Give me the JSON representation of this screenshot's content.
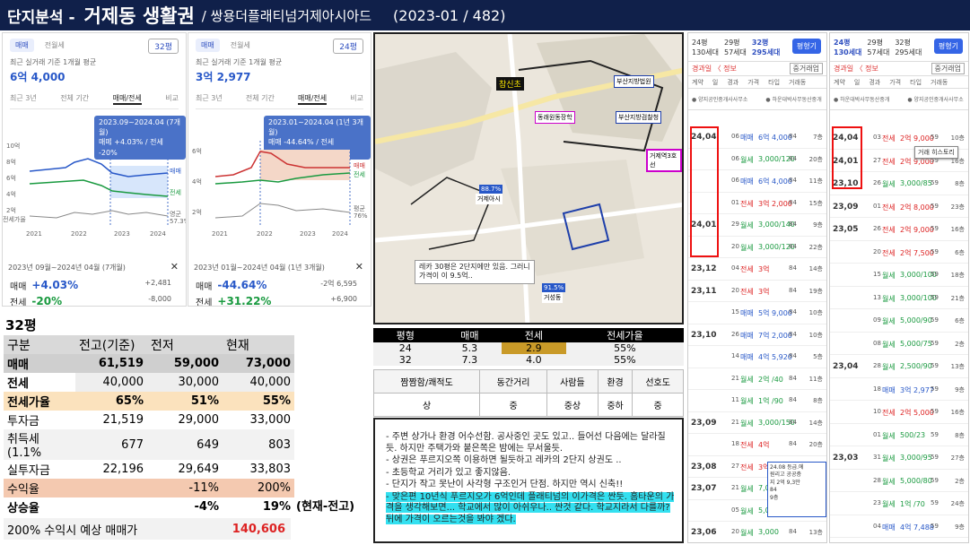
{
  "header": {
    "section": "단지분석 -",
    "region": "거제동 생활권",
    "complex": "/ 쌍용더플래티넘거제아시아드",
    "period": "(2023-01 / 482)"
  },
  "card_a": {
    "tab_sale": "매매",
    "tab_jeonse": "전월세",
    "size": "32평",
    "subtitle": "최근 실거래 기준 1개월 평균",
    "price": "6억 4,000",
    "period_tabs": [
      "최근 3년",
      "전체 기간",
      "매매/전세",
      "비교"
    ],
    "tooltip_line1": "2023.09~2024.04 (7개월)",
    "tooltip_line2": "매매 +4.03% / 전세 -20%",
    "y_ticks": [
      "10억",
      "8억",
      "6억",
      "4억",
      "2억"
    ],
    "x_ticks": [
      "2021",
      "2022",
      "2023",
      "2024"
    ],
    "legend": [
      "매매",
      "전세",
      "영군",
      "전세가율"
    ],
    "legend_extra": "57.3%",
    "range": "2023년 09월~2024년 04월 (7개월)",
    "stat_sale_label": "매매",
    "stat_sale": "+4.03%",
    "stat_sale_r": "+2,481",
    "stat_jeon_label": "전세",
    "stat_jeon": "-20%",
    "stat_jeon_r": "-8,000",
    "close_glyph": "✕"
  },
  "card_b": {
    "tab_sale": "매매",
    "tab_jeonse": "전월세",
    "size": "24평",
    "subtitle": "최근 실거래 기준 1개월 평균",
    "price": "3억 2,977",
    "period_tabs": [
      "최근 3년",
      "전체 기간",
      "매매/전세",
      "비교"
    ],
    "tooltip_line1": "2023.01~2024.04 (1년 3개월)",
    "tooltip_line2": "매매 -44.64% / 전세 +31.22%",
    "y_ticks": [
      "6억",
      "4억",
      "2억"
    ],
    "y_ticks_right": [
      "매매",
      "전세",
      "평균",
      "76%"
    ],
    "x_ticks": [
      "2021",
      "2022",
      "2023",
      "2024"
    ],
    "range": "2023년 01월~2024년 04월 (1년 3개월)",
    "stat_sale_label": "매매",
    "stat_sale": "-44.64%",
    "stat_sale_r": "-2억 6,595",
    "stat_jeon_label": "전세",
    "stat_jeon": "+31.22%",
    "stat_jeon_r": "+6,900",
    "close_glyph": "✕"
  },
  "map": {
    "labels": [
      "참신초",
      "부산지방법원",
      "동래원동장학",
      "부산지방검찰청",
      "거제역3호선",
      "88.7%",
      "거제아시",
      "91.5%",
      "거성동"
    ],
    "note_line1": "레카 30평은 2단지에만 있음. 그러니",
    "note_line2": "가격이 이 9.5억.."
  },
  "price_table": {
    "headers": [
      "평형",
      "매매",
      "전세",
      "전세가율"
    ],
    "rows": [
      [
        "24",
        "5.3",
        "2.9",
        "55%"
      ],
      [
        "32",
        "7.3",
        "4.0",
        "55%"
      ]
    ]
  },
  "eval_table": {
    "headers": [
      "짬짬함/쾌적도",
      "동간거리",
      "사람들",
      "환경",
      "선호도"
    ],
    "values": [
      "상",
      "중",
      "중상",
      "중하",
      "중"
    ]
  },
  "notes": [
    "-  주변 상가나 환경 어수선함. 공사중인 곳도 있고.. 들어선 다음에는 달라질듯. 하지만 주택가와 붙은쪽은 밤에는 무서울듯.",
    "-  상권은 푸르지오쪽 이용하면 될듯하고 레카의 2단지 상권도 ..",
    "-  초등학교 거리가 있고 좋지않음.",
    "-  단지가 작고 못난이 사각형 구조인거 단점. 하지만 역시 신축!!",
    "-  맞은편 10년식 푸르지오가 6억인데 플래티넘의 이가격은 싼듯. 홈타운의 가격을 생각해보면... 학교에서 많이 아쉬우나.. 싼것 같다.  학교지라서 다를까? 뒤에 가격이 오르는것을 봐야 겠다."
  ],
  "calc_table": {
    "title": "32평",
    "headers": [
      "구분",
      "전고(기준)",
      "전저",
      "현재"
    ],
    "rows": [
      [
        "매매",
        "61,519",
        "59,000",
        "73,000"
      ],
      [
        "전세",
        "40,000",
        "30,000",
        "40,000"
      ],
      [
        "전세가율",
        "65%",
        "51%",
        "55%"
      ],
      [
        "투자금",
        "21,519",
        "29,000",
        "33,000"
      ],
      [
        "취득세(1.1%",
        "677",
        "649",
        "803"
      ],
      [
        "실투자금",
        "22,196",
        "29,649",
        "33,803"
      ],
      [
        "수익율",
        "",
        "-11%",
        "200%"
      ],
      [
        "상승율",
        "",
        "-4%",
        "19%"
      ]
    ],
    "rise_note": "(현재-전고)",
    "expect_label": "200% 수익시 예상 매매가",
    "expect_value": "140,606"
  },
  "list_a": {
    "sizes": [
      "24평",
      "29평",
      "32평"
    ],
    "counts": [
      "130세대",
      "57세대",
      "295세대"
    ],
    "btn": "평형기",
    "bar2": "경과일 〈 정보",
    "bar2_btn": "중거래업",
    "cols": [
      "계약",
      "일",
      "경과",
      "가격",
      "타입",
      "거래동"
    ],
    "agent1": "양지공인중개사사무소",
    "agent2": "하운대박사무동산중개",
    "rows": [
      {
        "date": "24,04",
        "day": "06",
        "kind": "매매",
        "price": "6억 4,000",
        "fl": "84",
        "fx": "7층"
      },
      {
        "date": "",
        "day": "06",
        "kind": "월세",
        "price": "3,000/120",
        "fl": "84",
        "fx": "20층"
      },
      {
        "date": "",
        "day": "06",
        "kind": "매매",
        "price": "6억 4,000",
        "fl": "84",
        "fx": "11층"
      },
      {
        "date": "",
        "day": "01",
        "kind": "전세",
        "price": "3억 2,000",
        "fl": "84",
        "fx": "15층"
      },
      {
        "date": "24,01",
        "day": "29",
        "kind": "월세",
        "price": "3,000/140",
        "fl": "84",
        "fx": "9층"
      },
      {
        "date": "",
        "day": "20",
        "kind": "월세",
        "price": "3,000/120",
        "fl": "84",
        "fx": "22층"
      },
      {
        "date": "23,12",
        "day": "04",
        "kind": "전세",
        "price": "3억",
        "fl": "84",
        "fx": "14층"
      },
      {
        "date": "23,11",
        "day": "20",
        "kind": "전세",
        "price": "3억",
        "fl": "84",
        "fx": "19층"
      },
      {
        "date": "",
        "day": "15",
        "kind": "매매",
        "price": "5억 9,000",
        "fl": "84",
        "fx": "10층"
      },
      {
        "date": "23,10",
        "day": "26",
        "kind": "매매",
        "price": "7억 2,000",
        "fl": "84",
        "fx": "10층"
      },
      {
        "date": "",
        "day": "14",
        "kind": "매매",
        "price": "4억 5,920",
        "fl": "84",
        "fx": "5층"
      },
      {
        "date": "",
        "day": "21",
        "kind": "월세",
        "price": "2억 /40",
        "fl": "84",
        "fx": "11층"
      },
      {
        "date": "",
        "day": "11",
        "kind": "월세",
        "price": "1억 /90",
        "fl": "84",
        "fx": "8층"
      },
      {
        "date": "23,09",
        "day": "21",
        "kind": "월세",
        "price": "3,000/150",
        "fl": "84",
        "fx": "14층"
      },
      {
        "date": "",
        "day": "18",
        "kind": "전세",
        "price": "4억",
        "fl": "84",
        "fx": "20층"
      },
      {
        "date": "23,08",
        "day": "27",
        "kind": "전세",
        "price": "3억 7,",
        "fl": "84",
        "fx": "19층"
      },
      {
        "date": "23,07",
        "day": "21",
        "kind": "월세",
        "price": "7,000",
        "fl": "84",
        "fx": "7층"
      },
      {
        "date": "",
        "day": "05",
        "kind": "월세",
        "price": "5,000",
        "fl": "84",
        "fx": "5층"
      },
      {
        "date": "23,06",
        "day": "20",
        "kind": "월세",
        "price": "3,000",
        "fl": "84",
        "fx": "13층"
      }
    ],
    "popup": [
      "24.08 등급.에",
      "원리고 공공층",
      "지 2억 9,3만",
      "84",
      "9층"
    ]
  },
  "list_b": {
    "sizes": [
      "24평",
      "29평",
      "32평"
    ],
    "counts": [
      "130세대",
      "57세대",
      "295세대"
    ],
    "btn": "평형기",
    "bar2": "경과일 〈 정보",
    "bar2_btn": "중거래업",
    "cols": [
      "계약",
      "일",
      "경과",
      "가격",
      "타입",
      "거래동"
    ],
    "agent1": "하운대박사무동산중개",
    "agent2": "양지공인중개사사무소",
    "history_btn": "거래 히스토리",
    "rows": [
      {
        "date": "24,04",
        "day": "03",
        "kind": "전세",
        "price": "2억 9,000",
        "fl": "59",
        "fx": "10층"
      },
      {
        "date": "24,01",
        "day": "27",
        "kind": "전세",
        "price": "2억 9,000",
        "fl": "59",
        "fx": "16층"
      },
      {
        "date": "23,10",
        "day": "26",
        "kind": "월세",
        "price": "3,000/85",
        "fl": "59",
        "fx": "8층"
      },
      {
        "date": "23,09",
        "day": "01",
        "kind": "전세",
        "price": "2억 8,000",
        "fl": "59",
        "fx": "23층"
      },
      {
        "date": "23,05",
        "day": "26",
        "kind": "전세",
        "price": "2억 9,000",
        "fl": "59",
        "fx": "16층"
      },
      {
        "date": "",
        "day": "20",
        "kind": "전세",
        "price": "2억 7,500",
        "fl": "59",
        "fx": "6층"
      },
      {
        "date": "",
        "day": "15",
        "kind": "월세",
        "price": "3,000/100",
        "fl": "59",
        "fx": "18층"
      },
      {
        "date": "",
        "day": "13",
        "kind": "월세",
        "price": "3,000/100",
        "fl": "59",
        "fx": "21층"
      },
      {
        "date": "",
        "day": "09",
        "kind": "월세",
        "price": "5,000/90",
        "fl": "59",
        "fx": "6층"
      },
      {
        "date": "",
        "day": "08",
        "kind": "월세",
        "price": "5,000/75",
        "fl": "59",
        "fx": "2층"
      },
      {
        "date": "23,04",
        "day": "28",
        "kind": "월세",
        "price": "2,500/90",
        "fl": "59",
        "fx": "13층"
      },
      {
        "date": "",
        "day": "18",
        "kind": "매매",
        "price": "3억 2,977",
        "fl": "59",
        "fx": "9층"
      },
      {
        "date": "",
        "day": "10",
        "kind": "전세",
        "price": "2억 5,000",
        "fl": "59",
        "fx": "16층"
      },
      {
        "date": "",
        "day": "01",
        "kind": "월세",
        "price": "500/23",
        "fl": "59",
        "fx": "8층"
      },
      {
        "date": "23,03",
        "day": "31",
        "kind": "월세",
        "price": "3,000/95",
        "fl": "59",
        "fx": "27층"
      },
      {
        "date": "",
        "day": "28",
        "kind": "월세",
        "price": "5,000/80",
        "fl": "59",
        "fx": "2층"
      },
      {
        "date": "",
        "day": "23",
        "kind": "월세",
        "price": "1억 /70",
        "fl": "59",
        "fx": "24층"
      },
      {
        "date": "",
        "day": "04",
        "kind": "매매",
        "price": "4억 7,488",
        "fl": "59",
        "fx": "9층"
      }
    ]
  }
}
